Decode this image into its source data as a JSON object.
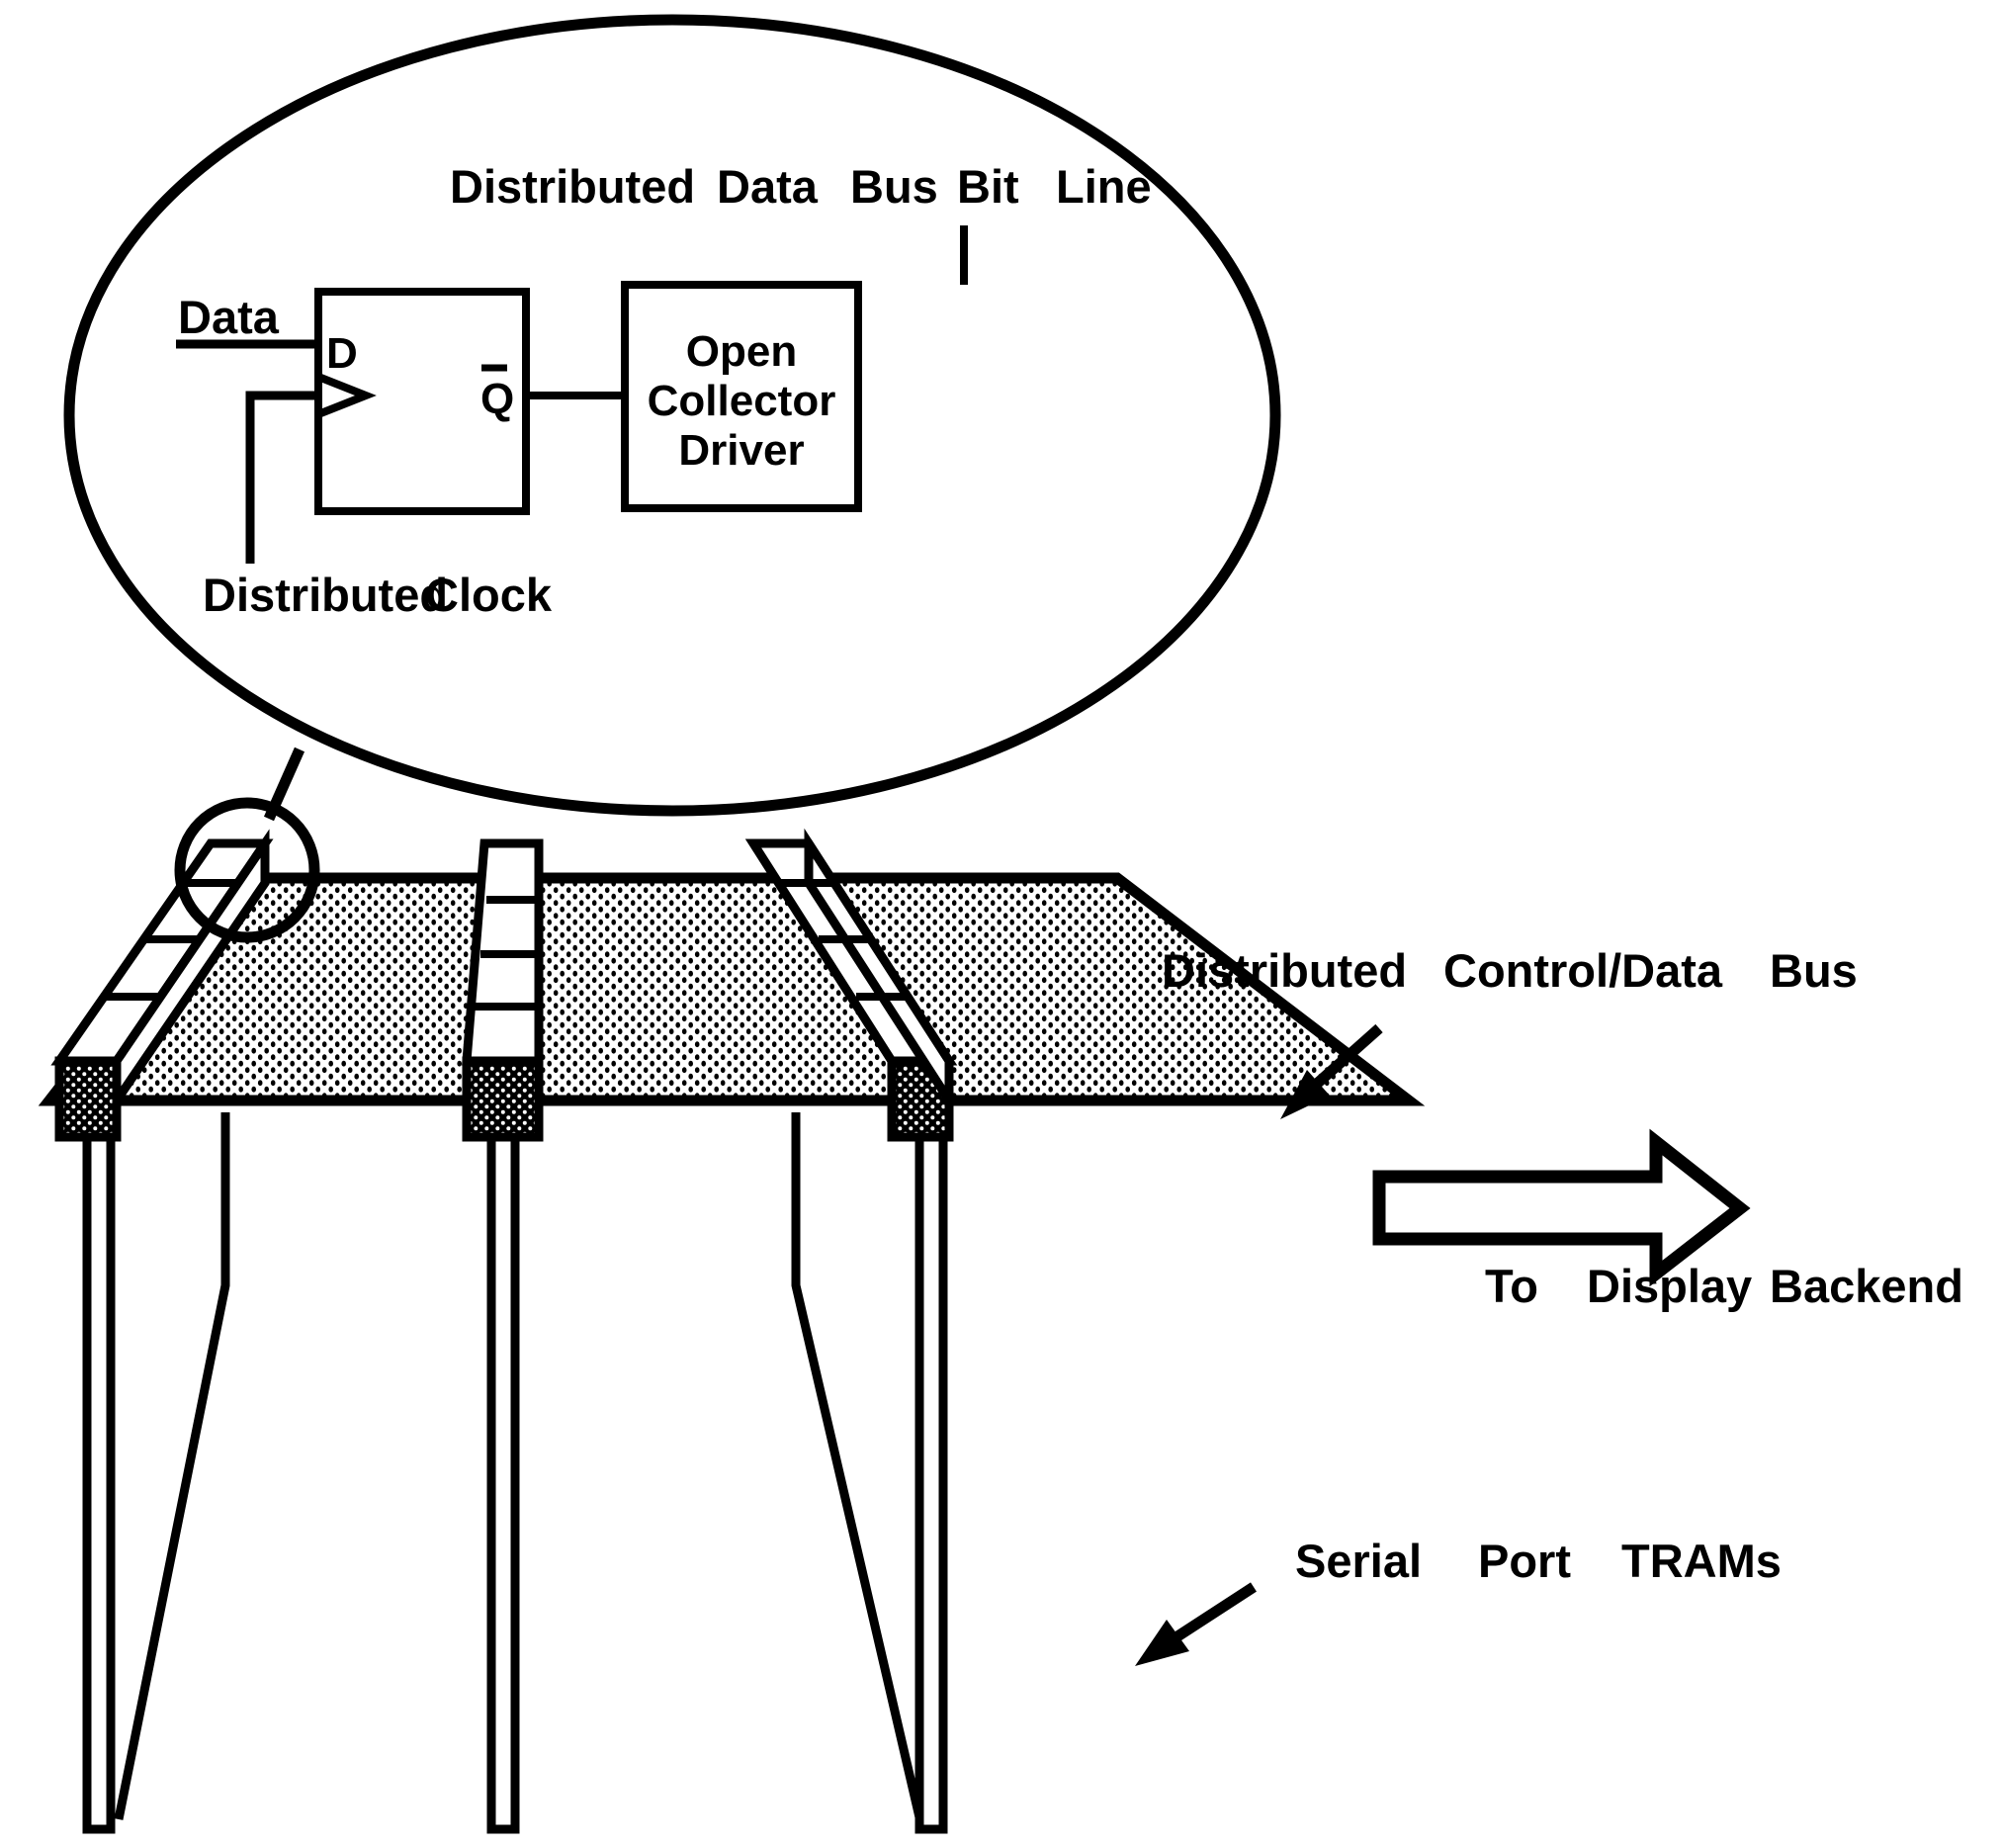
{
  "figure": {
    "kind": "technical-block-diagram",
    "title_visible": false,
    "ink_color": "#000000",
    "background_color": "#ffffff"
  },
  "callout": {
    "shape": "ellipse",
    "heading": "Distributed   Data Bus Bit   Line",
    "heading_words": [
      "Distributed",
      "Data",
      "Bus",
      "Bit",
      "Line"
    ],
    "clock_label": "Distributed    Clock",
    "clock_label_words": [
      "Distributed",
      "Clock"
    ],
    "data_input_label": "Data",
    "flipflop": {
      "d_input_pin": "D",
      "q_output_pin": "Q",
      "q_is_inverted": true,
      "has_clock_triangle": true
    },
    "driver": {
      "line1": "Open",
      "line2": "Collector",
      "line3": "Driver"
    }
  },
  "board": {
    "bus_label": "Distributed    Control/Data    Bus",
    "bus_label_words": [
      "Distributed",
      "Control/Data",
      "Bus"
    ],
    "backend_label": "To   Display   Backend",
    "backend_label_words": [
      "To",
      "Display",
      "Backend"
    ],
    "tram_label": "Serial   Port   TRAMs",
    "tram_label_words": [
      "Serial",
      "Port",
      "TRAMs"
    ],
    "tram_bar_count": 3,
    "segments_per_bar": 4,
    "leg_count": 3,
    "surface_fill": "stipple-dots",
    "endcap_fill": "dark-stipple",
    "flow_arrow_direction": "right",
    "flow_arrow_style": "hollow-block"
  }
}
